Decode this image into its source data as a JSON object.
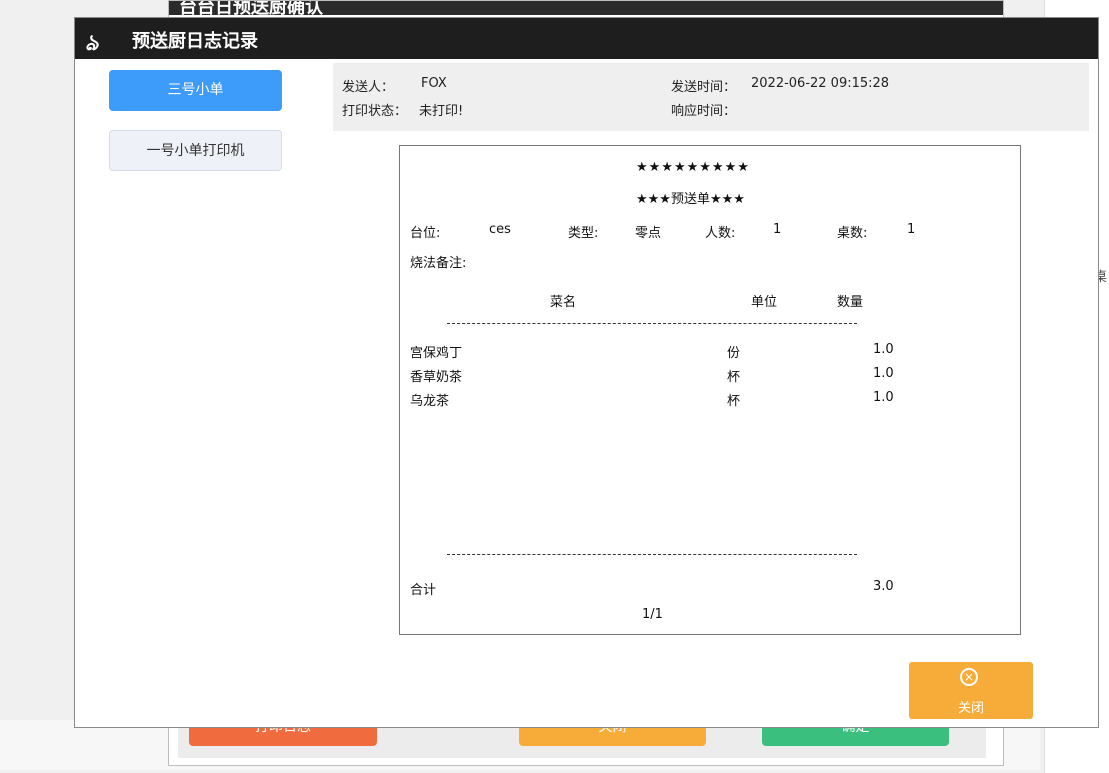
{
  "background": {
    "dialog_title": "台台日预送厨确认",
    "right_labels": [
      ":",
      ":",
      ":",
      ":",
      "桌"
    ],
    "footer_buttons": [
      {
        "label": "打印日志",
        "color": "#f06b3e"
      },
      {
        "label": "关闭",
        "color": "#f7ac3a"
      },
      {
        "label": "确定",
        "color": "#3bbf7e"
      }
    ]
  },
  "modal": {
    "logo": "ঌ",
    "title": "预送厨日志记录",
    "printers": [
      {
        "label": "三号小单",
        "active": true
      },
      {
        "label": "一号小单打印机",
        "active": false
      }
    ],
    "info": {
      "sender_label": "发送人：",
      "sender_value": "FOX",
      "send_time_label": "发送时间：",
      "send_time_value": "2022-06-22 09:15:28",
      "print_status_label": "打印状态：",
      "print_status_value": "未打印!",
      "response_time_label": "响应时间：",
      "response_time_value": ""
    },
    "receipt": {
      "stars": "★★★★★★★★★",
      "heading": "★★★预送单★★★",
      "table_label": "台位:",
      "table_value": "ces",
      "type_label": "类型:",
      "type_value": "零点",
      "people_label": "人数:",
      "people_value": "1",
      "desks_label": "桌数:",
      "desks_value": "1",
      "note_label": "烧法备注:",
      "col_name": "菜名",
      "col_unit": "单位",
      "col_qty": "数量",
      "items": [
        {
          "name": "宫保鸡丁",
          "unit": "份",
          "qty": "1.0"
        },
        {
          "name": "香草奶茶",
          "unit": "杯",
          "qty": "1.0"
        },
        {
          "name": "乌龙茶",
          "unit": "杯",
          "qty": "1.0"
        }
      ],
      "total_label": "合计",
      "total_value": "3.0",
      "page": "1/1"
    },
    "close_button": {
      "icon": "close-circle-icon",
      "label": "关闭"
    }
  }
}
